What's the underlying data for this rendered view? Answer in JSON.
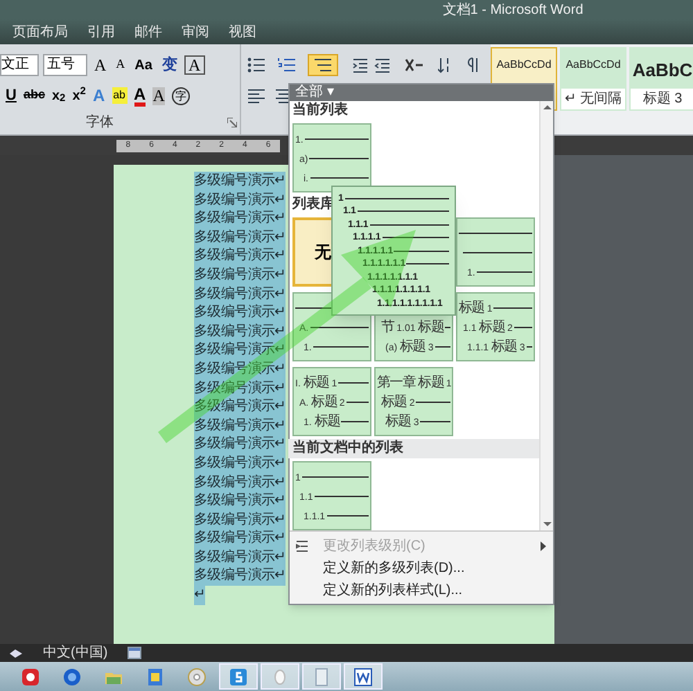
{
  "window": {
    "title": "文档1 - Microsoft Word"
  },
  "tabs": [
    {
      "label": "页面布局",
      "selected": false
    },
    {
      "label": "引用",
      "selected": false
    },
    {
      "label": "邮件",
      "selected": false
    },
    {
      "label": "审阅",
      "selected": false
    },
    {
      "label": "视图",
      "selected": false
    }
  ],
  "ribbon": {
    "font_name": "文正",
    "font_size": "五号",
    "font_row_buttons": [
      {
        "kind": "grow",
        "glyph": "A"
      },
      {
        "kind": "shrink",
        "glyph": "A"
      },
      {
        "kind": "case",
        "glyph": "Aa"
      },
      {
        "kind": "phonetic",
        "glyph": "变"
      },
      {
        "kind": "border",
        "glyph": "A"
      }
    ],
    "format_row_buttons": [
      {
        "kind": "underline",
        "glyph": "U"
      },
      {
        "kind": "strike",
        "glyph": "abc"
      },
      {
        "kind": "plain",
        "glyph": "x$_{2}$"
      },
      {
        "kind": "plain",
        "glyph": "x$^{2}$"
      },
      {
        "kind": "effect",
        "glyph": "A"
      },
      {
        "kind": "highlight",
        "glyph": "ab"
      },
      {
        "kind": "fontcolor",
        "glyph": "A"
      },
      {
        "kind": "shading",
        "glyph": "A"
      },
      {
        "kind": "enclose",
        "glyph": "字"
      }
    ],
    "group_label": "字体",
    "multilevel_list_open": true,
    "styles": [
      {
        "preview": "AaBbCcDd",
        "selected": true
      },
      {
        "preview": "AaBbCcDd",
        "label": "↵ 无间隔",
        "selected": false
      },
      {
        "preview": "AaBbC",
        "label": "标题 3",
        "selected": false
      }
    ]
  },
  "ruler": {
    "numbers": [
      "8",
      "6",
      "4",
      "2",
      "2",
      "4",
      "6"
    ]
  },
  "document": {
    "lines": [
      {
        "text": "多级编号演示↵",
        "selected": true
      },
      {
        "text": "多级编号演示↵",
        "selected": true
      },
      {
        "text": "多级编号演示↵",
        "selected": true
      },
      {
        "text": "多级编号演示↵",
        "selected": true
      },
      {
        "text": "多级编号演示↵",
        "selected": true
      },
      {
        "text": "多级编号演示↵",
        "selected": true
      },
      {
        "text": "多级编号演示↵",
        "selected": true
      },
      {
        "text": "多级编号演示↵",
        "selected": true
      },
      {
        "text": "多级编号演示↵",
        "selected": true
      },
      {
        "text": "多级编号演示↵",
        "selected": true
      },
      {
        "text": "多级编号演示↵",
        "selected": true
      },
      {
        "text": "多级编号演示↵",
        "selected": true
      },
      {
        "text": "多级编号演示↵",
        "selected": true
      },
      {
        "text": "多级编号演示↵",
        "selected": true
      },
      {
        "text": "多级编号演示↵",
        "selected": true
      },
      {
        "text": "多级编号演示↵",
        "selected": true
      },
      {
        "text": "多级编号演示↵",
        "selected": true
      },
      {
        "text": "多级编号演示↵",
        "selected": true
      },
      {
        "text": "多级编号演示↵",
        "selected": true
      },
      {
        "text": "多级编号演示↵",
        "selected": true
      },
      {
        "text": "多级编号演示↵",
        "selected": true
      },
      {
        "text": "多级编号演示↵",
        "selected": true
      },
      {
        "text": "↵",
        "selected": true
      }
    ]
  },
  "list_menu": {
    "filter": "全部 ▾",
    "current_list": {
      "heading": "当前列表",
      "thumbnails": [
        {
          "kind": "list",
          "selected": false,
          "rows": [
            {
              "text": "1."
            },
            {
              "text": "a)"
            },
            {
              "text": "i."
            }
          ]
        }
      ]
    },
    "library": {
      "heading": "列表库",
      "thumbnails": [
        {
          "kind": "none",
          "label": "无",
          "selected": true
        },
        {
          "kind": "covered"
        },
        {
          "kind": "list",
          "selected": false,
          "rows": [
            {},
            {},
            {
              "text": "1."
            }
          ]
        },
        {
          "kind": "list",
          "selected": false,
          "rows": [
            {},
            {
              "text": "A."
            },
            {
              "text": "1."
            }
          ]
        },
        {
          "kind": "list",
          "selected": false,
          "rows": [
            {},
            {
              "text": "节 1.01 标题"
            },
            {
              "text": "(a) 标题 3"
            }
          ]
        },
        {
          "kind": "list",
          "selected": false,
          "rows": [
            {
              "text": "标题 1"
            },
            {
              "text": "1.1 标题 2"
            },
            {
              "text": "1.1.1 标题 3"
            }
          ]
        },
        {
          "kind": "list",
          "selected": false,
          "rows": [
            {
              "text": "I. 标题 1"
            },
            {
              "text": "A. 标题 2"
            },
            {
              "text": "1. 标题"
            }
          ]
        },
        {
          "kind": "list",
          "selected": false,
          "rows": [
            {
              "text": "第一章 标题 1"
            },
            {
              "text": "标题 2"
            },
            {
              "text": "标题 3"
            }
          ]
        }
      ]
    },
    "document_lists": {
      "heading": "当前文档中的列表",
      "thumbnails": [
        {
          "kind": "list",
          "selected": false,
          "rows": [
            {
              "text": "1"
            },
            {
              "text": "1.1"
            },
            {
              "text": "1.1.1"
            }
          ]
        }
      ]
    },
    "items": [
      {
        "label": "更改列表级别(C)",
        "disabled": true,
        "submenu": true
      },
      {
        "label": "定义新的多级列表(D)...",
        "disabled": false,
        "submenu": false
      },
      {
        "label": "定义新的列表样式(L)...",
        "disabled": false,
        "submenu": false
      }
    ]
  },
  "preview": {
    "lines": [
      "1",
      "1.1",
      "1.1.1",
      "1.1.1.1",
      "1.1.1.1.1",
      "1.1.1.1.1.1",
      "1.1.1.1.1.1.1",
      "1.1.1.1.1.1.1.1",
      "1.1.1.1.1.1.1.1.1"
    ]
  },
  "status_bar": {
    "language": "中文(中国)"
  },
  "taskbar": {
    "apps": [
      {
        "kind": "media",
        "running": false
      },
      {
        "kind": "browser",
        "running": false
      },
      {
        "kind": "folder",
        "running": false
      },
      {
        "kind": "photos",
        "running": false
      },
      {
        "kind": "disc",
        "running": false
      },
      {
        "kind": "letter",
        "running": true
      },
      {
        "kind": "oval",
        "running": true
      },
      {
        "kind": "document",
        "running": true
      },
      {
        "kind": "word",
        "running": true
      }
    ]
  }
}
